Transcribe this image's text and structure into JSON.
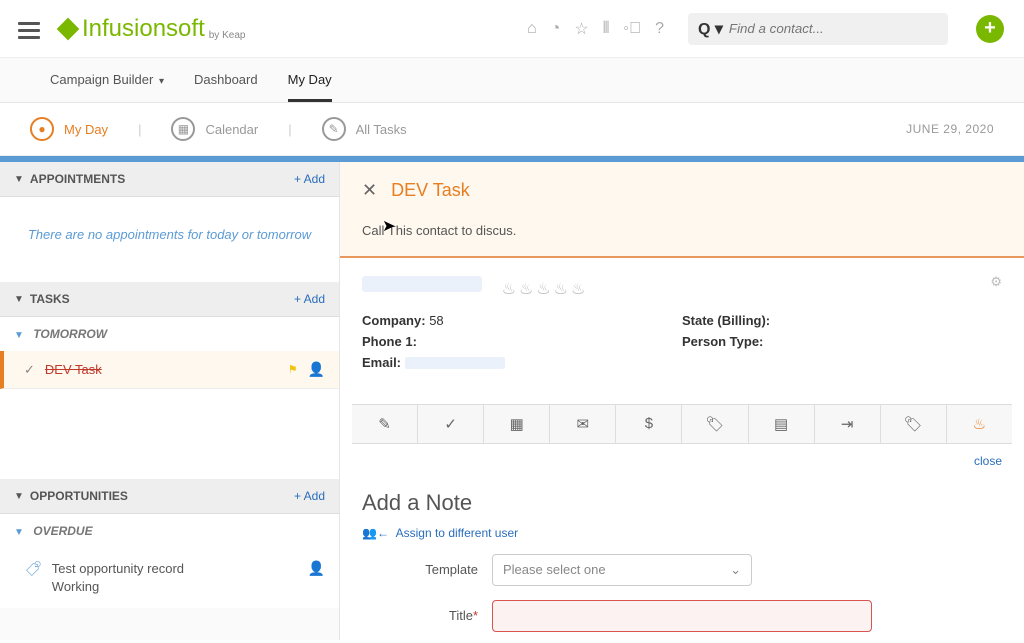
{
  "logo": {
    "text": "Infusionsoft",
    "sub": "by Keap"
  },
  "search": {
    "placeholder": "Find a contact..."
  },
  "nav": {
    "campaign": "Campaign Builder",
    "dashboard": "Dashboard",
    "myday": "My Day"
  },
  "subnav": {
    "myday": "My Day",
    "calendar": "Calendar",
    "alltasks": "All Tasks",
    "date": "JUNE 29, 2020"
  },
  "sections": {
    "appointments": {
      "title": "APPOINTMENTS",
      "add": "+ Add",
      "empty": "There are no appointments for today or tomorrow"
    },
    "tasks": {
      "title": "TASKS",
      "add": "+ Add",
      "group": "TOMORROW",
      "item": "DEV Task"
    },
    "opportunities": {
      "title": "OPPORTUNITIES",
      "add": "+ Add",
      "group": "OVERDUE",
      "item_line1": "Test opportunity record",
      "item_line2": "Working"
    }
  },
  "detail": {
    "title": "DEV Task",
    "description": "Call This contact to discus.",
    "company_label": "Company:",
    "company_value": "58",
    "phone_label": "Phone 1:",
    "email_label": "Email:",
    "state_label": "State (Billing):",
    "person_label": "Person Type:",
    "close": "close",
    "note_heading": "Add a Note",
    "assign": "Assign to different user",
    "template_label": "Template",
    "template_placeholder": "Please select one",
    "title_label": "Title",
    "req": "*"
  }
}
